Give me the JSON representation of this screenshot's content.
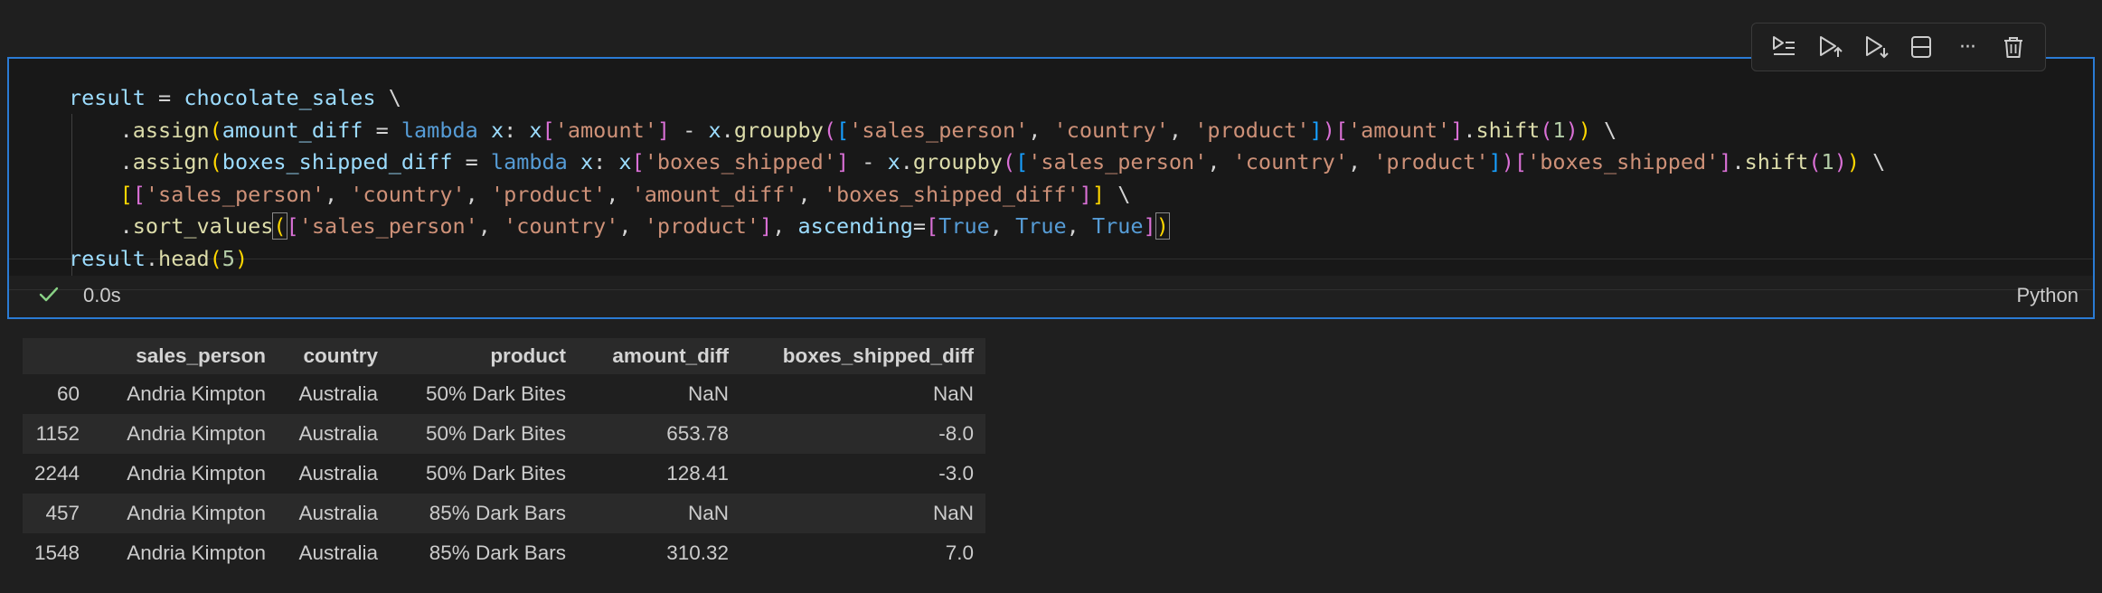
{
  "toolbar": {
    "buttons": [
      {
        "icon": "run-by-line-icon"
      },
      {
        "icon": "execute-above-icon"
      },
      {
        "icon": "execute-below-icon"
      },
      {
        "icon": "split-cell-icon"
      },
      {
        "icon": "more-actions-icon",
        "glyph": "···"
      },
      {
        "icon": "delete-cell-icon"
      }
    ]
  },
  "cell": {
    "exec_time": "0.0s",
    "language": "Python",
    "accent_color": "#2a7bd4",
    "code_lines": [
      [
        {
          "t": "result",
          "c": "t-var"
        },
        {
          "t": " = ",
          "c": "t-plain"
        },
        {
          "t": "chocolate_sales",
          "c": "t-var"
        },
        {
          "t": " \\",
          "c": "t-plain"
        }
      ],
      [
        {
          "t": "    .",
          "c": "t-plain"
        },
        {
          "t": "assign",
          "c": "t-fn"
        },
        {
          "t": "(",
          "c": "t-br1"
        },
        {
          "t": "amount_diff",
          "c": "t-var"
        },
        {
          "t": " = ",
          "c": "t-plain"
        },
        {
          "t": "lambda",
          "c": "t-kw"
        },
        {
          "t": " ",
          "c": "t-plain"
        },
        {
          "t": "x",
          "c": "t-var"
        },
        {
          "t": ": ",
          "c": "t-plain"
        },
        {
          "t": "x",
          "c": "t-var"
        },
        {
          "t": "[",
          "c": "t-br2"
        },
        {
          "t": "'amount'",
          "c": "t-str"
        },
        {
          "t": "]",
          "c": "t-br2"
        },
        {
          "t": " - ",
          "c": "t-plain"
        },
        {
          "t": "x",
          "c": "t-var"
        },
        {
          "t": ".",
          "c": "t-plain"
        },
        {
          "t": "groupby",
          "c": "t-fn"
        },
        {
          "t": "(",
          "c": "t-br2"
        },
        {
          "t": "[",
          "c": "t-br3"
        },
        {
          "t": "'sales_person'",
          "c": "t-str"
        },
        {
          "t": ", ",
          "c": "t-plain"
        },
        {
          "t": "'country'",
          "c": "t-str"
        },
        {
          "t": ", ",
          "c": "t-plain"
        },
        {
          "t": "'product'",
          "c": "t-str"
        },
        {
          "t": "]",
          "c": "t-br3"
        },
        {
          "t": ")",
          "c": "t-br2"
        },
        {
          "t": "[",
          "c": "t-br2"
        },
        {
          "t": "'amount'",
          "c": "t-str"
        },
        {
          "t": "]",
          "c": "t-br2"
        },
        {
          "t": ".",
          "c": "t-plain"
        },
        {
          "t": "shift",
          "c": "t-fn"
        },
        {
          "t": "(",
          "c": "t-br2"
        },
        {
          "t": "1",
          "c": "t-num"
        },
        {
          "t": ")",
          "c": "t-br2"
        },
        {
          "t": ")",
          "c": "t-br1"
        },
        {
          "t": " \\",
          "c": "t-plain"
        }
      ],
      [
        {
          "t": "    .",
          "c": "t-plain"
        },
        {
          "t": "assign",
          "c": "t-fn"
        },
        {
          "t": "(",
          "c": "t-br1"
        },
        {
          "t": "boxes_shipped_diff",
          "c": "t-var"
        },
        {
          "t": " = ",
          "c": "t-plain"
        },
        {
          "t": "lambda",
          "c": "t-kw"
        },
        {
          "t": " ",
          "c": "t-plain"
        },
        {
          "t": "x",
          "c": "t-var"
        },
        {
          "t": ": ",
          "c": "t-plain"
        },
        {
          "t": "x",
          "c": "t-var"
        },
        {
          "t": "[",
          "c": "t-br2"
        },
        {
          "t": "'boxes_shipped'",
          "c": "t-str"
        },
        {
          "t": "]",
          "c": "t-br2"
        },
        {
          "t": " - ",
          "c": "t-plain"
        },
        {
          "t": "x",
          "c": "t-var"
        },
        {
          "t": ".",
          "c": "t-plain"
        },
        {
          "t": "groupby",
          "c": "t-fn"
        },
        {
          "t": "(",
          "c": "t-br2"
        },
        {
          "t": "[",
          "c": "t-br3"
        },
        {
          "t": "'sales_person'",
          "c": "t-str"
        },
        {
          "t": ", ",
          "c": "t-plain"
        },
        {
          "t": "'country'",
          "c": "t-str"
        },
        {
          "t": ", ",
          "c": "t-plain"
        },
        {
          "t": "'product'",
          "c": "t-str"
        },
        {
          "t": "]",
          "c": "t-br3"
        },
        {
          "t": ")",
          "c": "t-br2"
        },
        {
          "t": "[",
          "c": "t-br2"
        },
        {
          "t": "'boxes_shipped'",
          "c": "t-str"
        },
        {
          "t": "]",
          "c": "t-br2"
        },
        {
          "t": ".",
          "c": "t-plain"
        },
        {
          "t": "shift",
          "c": "t-fn"
        },
        {
          "t": "(",
          "c": "t-br2"
        },
        {
          "t": "1",
          "c": "t-num"
        },
        {
          "t": ")",
          "c": "t-br2"
        },
        {
          "t": ")",
          "c": "t-br1"
        },
        {
          "t": " \\",
          "c": "t-plain"
        }
      ],
      [
        {
          "t": "    ",
          "c": "t-plain"
        },
        {
          "t": "[",
          "c": "t-br1"
        },
        {
          "t": "[",
          "c": "t-br2"
        },
        {
          "t": "'sales_person'",
          "c": "t-str"
        },
        {
          "t": ", ",
          "c": "t-plain"
        },
        {
          "t": "'country'",
          "c": "t-str"
        },
        {
          "t": ", ",
          "c": "t-plain"
        },
        {
          "t": "'product'",
          "c": "t-str"
        },
        {
          "t": ", ",
          "c": "t-plain"
        },
        {
          "t": "'amount_diff'",
          "c": "t-str"
        },
        {
          "t": ", ",
          "c": "t-plain"
        },
        {
          "t": "'boxes_shipped_diff'",
          "c": "t-str"
        },
        {
          "t": "]",
          "c": "t-br2"
        },
        {
          "t": "]",
          "c": "t-br1"
        },
        {
          "t": " \\",
          "c": "t-plain"
        }
      ],
      [
        {
          "t": "    .",
          "c": "t-plain"
        },
        {
          "t": "sort_values",
          "c": "t-fn"
        },
        {
          "t": "(",
          "c": "t-br1 bm"
        },
        {
          "t": "[",
          "c": "t-br2"
        },
        {
          "t": "'sales_person'",
          "c": "t-str"
        },
        {
          "t": ", ",
          "c": "t-plain"
        },
        {
          "t": "'country'",
          "c": "t-str"
        },
        {
          "t": ", ",
          "c": "t-plain"
        },
        {
          "t": "'product'",
          "c": "t-str"
        },
        {
          "t": "]",
          "c": "t-br2"
        },
        {
          "t": ", ",
          "c": "t-plain"
        },
        {
          "t": "ascending",
          "c": "t-var"
        },
        {
          "t": "=",
          "c": "t-plain"
        },
        {
          "t": "[",
          "c": "t-br2"
        },
        {
          "t": "True",
          "c": "t-kw"
        },
        {
          "t": ", ",
          "c": "t-plain"
        },
        {
          "t": "True",
          "c": "t-kw"
        },
        {
          "t": ", ",
          "c": "t-plain"
        },
        {
          "t": "True",
          "c": "t-kw"
        },
        {
          "t": "]",
          "c": "t-br2"
        },
        {
          "t": ")",
          "c": "t-br1 bm"
        }
      ],
      [
        {
          "t": "result",
          "c": "t-var"
        },
        {
          "t": ".",
          "c": "t-plain"
        },
        {
          "t": "head",
          "c": "t-fn"
        },
        {
          "t": "(",
          "c": "t-br1"
        },
        {
          "t": "5",
          "c": "t-num"
        },
        {
          "t": ")",
          "c": "t-br1"
        }
      ]
    ]
  },
  "output": {
    "columns": [
      "",
      "sales_person",
      "country",
      "product",
      "amount_diff",
      "boxes_shipped_diff"
    ],
    "rows": [
      [
        "60",
        "Andria Kimpton",
        "Australia",
        "50% Dark Bites",
        "NaN",
        "NaN"
      ],
      [
        "1152",
        "Andria Kimpton",
        "Australia",
        "50% Dark Bites",
        "653.78",
        "-8.0"
      ],
      [
        "2244",
        "Andria Kimpton",
        "Australia",
        "50% Dark Bites",
        "128.41",
        "-3.0"
      ],
      [
        "457",
        "Andria Kimpton",
        "Australia",
        "85% Dark Bars",
        "NaN",
        "NaN"
      ],
      [
        "1548",
        "Andria Kimpton",
        "Australia",
        "85% Dark Bars",
        "310.32",
        "7.0"
      ]
    ]
  }
}
